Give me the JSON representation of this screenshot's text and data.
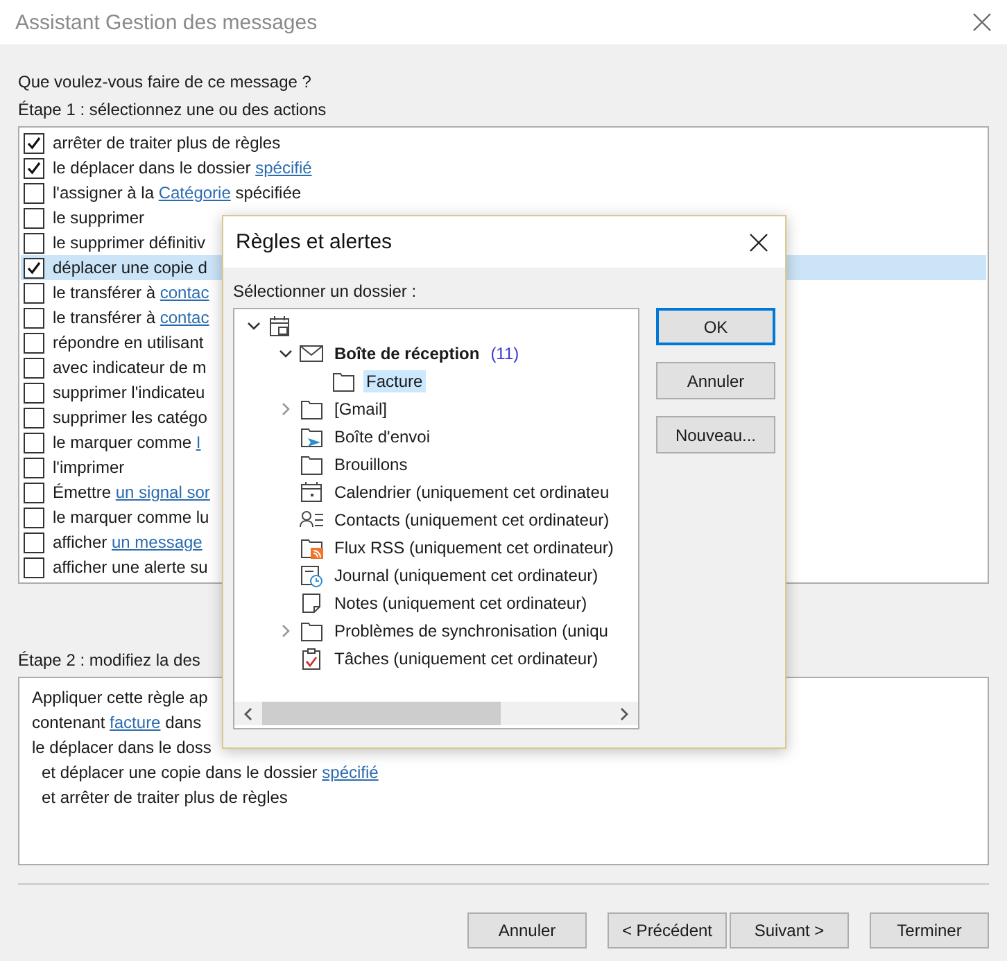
{
  "window": {
    "title": "Assistant Gestion des messages"
  },
  "question": "Que voulez-vous faire de ce message ?",
  "step1": {
    "label": "Étape 1 : sélectionnez une ou des actions",
    "actions": [
      {
        "checked": true,
        "selected": false,
        "parts": [
          {
            "text": "arrêter de traiter plus de règles"
          }
        ]
      },
      {
        "checked": true,
        "selected": false,
        "parts": [
          {
            "text": "le déplacer dans le dossier "
          },
          {
            "link": "spécifié"
          }
        ]
      },
      {
        "checked": false,
        "selected": false,
        "parts": [
          {
            "text": "l'assigner à la "
          },
          {
            "link": "Catégorie"
          },
          {
            "text": " spécifiée"
          }
        ]
      },
      {
        "checked": false,
        "selected": false,
        "parts": [
          {
            "text": "le supprimer"
          }
        ]
      },
      {
        "checked": false,
        "selected": false,
        "parts": [
          {
            "text": "le supprimer définitiv"
          }
        ]
      },
      {
        "checked": true,
        "selected": true,
        "parts": [
          {
            "text": "déplacer une copie d"
          }
        ]
      },
      {
        "checked": false,
        "selected": false,
        "parts": [
          {
            "text": "le transférer à "
          },
          {
            "link": "contac"
          }
        ]
      },
      {
        "checked": false,
        "selected": false,
        "parts": [
          {
            "text": "le transférer à "
          },
          {
            "link": "contac"
          }
        ]
      },
      {
        "checked": false,
        "selected": false,
        "parts": [
          {
            "text": "répondre en utilisant"
          }
        ]
      },
      {
        "checked": false,
        "selected": false,
        "parts": [
          {
            "text": "avec indicateur de m"
          }
        ]
      },
      {
        "checked": false,
        "selected": false,
        "parts": [
          {
            "text": "supprimer l'indicateu"
          }
        ]
      },
      {
        "checked": false,
        "selected": false,
        "parts": [
          {
            "text": "supprimer les catégo"
          }
        ]
      },
      {
        "checked": false,
        "selected": false,
        "parts": [
          {
            "text": "le marquer comme "
          },
          {
            "link": "I"
          }
        ]
      },
      {
        "checked": false,
        "selected": false,
        "parts": [
          {
            "text": "l'imprimer"
          }
        ]
      },
      {
        "checked": false,
        "selected": false,
        "parts": [
          {
            "text": "Émettre "
          },
          {
            "link": "un signal sor"
          }
        ]
      },
      {
        "checked": false,
        "selected": false,
        "parts": [
          {
            "text": "le marquer comme lu"
          }
        ]
      },
      {
        "checked": false,
        "selected": false,
        "parts": [
          {
            "text": "afficher "
          },
          {
            "link": "un message"
          }
        ]
      },
      {
        "checked": false,
        "selected": false,
        "parts": [
          {
            "text": "afficher une alerte su"
          }
        ]
      }
    ]
  },
  "step2": {
    "label": "Étape 2 : modifiez la des",
    "lines": [
      {
        "parts": [
          {
            "text": "Appliquer cette règle ap"
          }
        ]
      },
      {
        "parts": [
          {
            "text": "contenant "
          },
          {
            "link": "facture"
          },
          {
            "text": " dans"
          }
        ]
      },
      {
        "parts": [
          {
            "text": "le déplacer dans le doss"
          }
        ],
        "children": [
          {
            "parts": [
              {
                "text": "et déplacer une copie dans le dossier "
              },
              {
                "link": "spécifié"
              }
            ]
          },
          {
            "parts": [
              {
                "text": "et arrêter de traiter plus de règles"
              }
            ]
          }
        ]
      }
    ]
  },
  "buttons": [
    {
      "label": "Annuler"
    },
    {
      "label": "< Précédent"
    },
    {
      "label": "Suivant >"
    },
    {
      "label": "Terminer"
    }
  ],
  "dialog": {
    "title": "Règles et alertes",
    "prompt": "Sélectionner un dossier :",
    "tree": [
      {
        "kind": "store",
        "expanded": true,
        "selected": false,
        "children": [
          {
            "kind": "mail",
            "label": "Boîte de réception",
            "count": "(11)",
            "expanded": true,
            "selected": false,
            "children": [
              {
                "kind": "folder",
                "label": "Facture",
                "selected": true
              }
            ]
          },
          {
            "kind": "folder",
            "label": "[Gmail]",
            "expanded": false,
            "selected": false
          },
          {
            "kind": "outbox",
            "label": "Boîte d'envoi",
            "selected": false
          },
          {
            "kind": "folder",
            "label": "Brouillons",
            "selected": false
          },
          {
            "kind": "calendar",
            "label": "Calendrier (uniquement cet ordinateu",
            "selected": false
          },
          {
            "kind": "contacts",
            "label": "Contacts (uniquement cet ordinateur)",
            "selected": false
          },
          {
            "kind": "rss",
            "label": "Flux RSS (uniquement cet ordinateur)",
            "selected": false
          },
          {
            "kind": "journal",
            "label": "Journal (uniquement cet ordinateur)",
            "selected": false
          },
          {
            "kind": "notes",
            "label": "Notes (uniquement cet ordinateur)",
            "selected": false
          },
          {
            "kind": "folder",
            "label": "Problèmes de synchronisation (uniqu",
            "expanded": false,
            "selected": false
          },
          {
            "kind": "tasks",
            "label": "Tâches (uniquement cet ordinateur)",
            "selected": false
          }
        ]
      }
    ],
    "buttons": [
      {
        "label": "OK",
        "default": true
      },
      {
        "label": "Annuler",
        "default": false
      },
      {
        "label": "Nouveau...",
        "default": false
      }
    ]
  }
}
